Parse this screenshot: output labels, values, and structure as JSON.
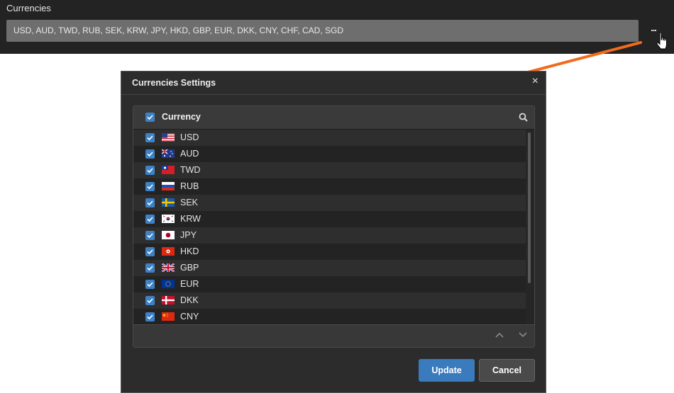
{
  "top": {
    "label": "Currencies",
    "value": "USD, AUD, TWD, RUB, SEK, KRW, JPY, HKD, GBP, EUR, DKK, CNY, CHF, CAD, SGD",
    "more_label": "..."
  },
  "dialog": {
    "title": "Currencies Settings",
    "close_label": "×",
    "column_header": "Currency",
    "rows": [
      {
        "code": "USD",
        "flag": "us-flag-icon"
      },
      {
        "code": "AUD",
        "flag": "au-flag-icon"
      },
      {
        "code": "TWD",
        "flag": "tw-flag-icon"
      },
      {
        "code": "RUB",
        "flag": "ru-flag-icon"
      },
      {
        "code": "SEK",
        "flag": "se-flag-icon"
      },
      {
        "code": "KRW",
        "flag": "kr-flag-icon"
      },
      {
        "code": "JPY",
        "flag": "jp-flag-icon"
      },
      {
        "code": "HKD",
        "flag": "hk-flag-icon"
      },
      {
        "code": "GBP",
        "flag": "gb-flag-icon"
      },
      {
        "code": "EUR",
        "flag": "eu-flag-icon"
      },
      {
        "code": "DKK",
        "flag": "dk-flag-icon"
      },
      {
        "code": "CNY",
        "flag": "cn-flag-icon"
      }
    ],
    "update_label": "Update",
    "cancel_label": "Cancel"
  },
  "colors": {
    "accent": "#3d82c6",
    "arrow": "#f26b1d"
  }
}
